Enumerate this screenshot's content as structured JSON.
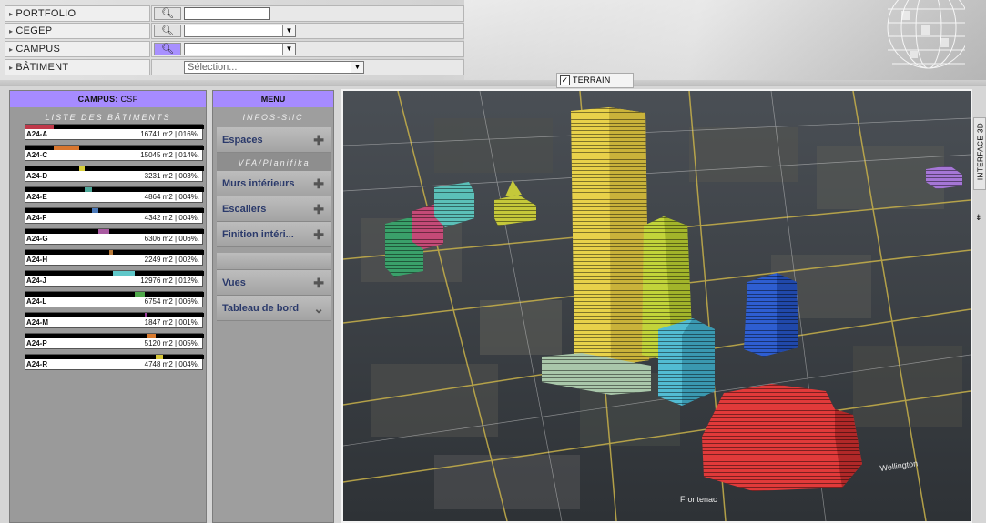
{
  "filters": {
    "portfolio_label": "PORTFOLIO",
    "cegep_label": "CEGEP",
    "campus_label": "CAMPUS",
    "batiment_label": "BÂTIMENT",
    "batiment_placeholder": "Sélection...",
    "search_icon": "magnifier-icon"
  },
  "terrain": {
    "label": "TERRAIN",
    "checked": true
  },
  "campus_panel": {
    "header_label": "CAMPUS:",
    "header_value": "CSF",
    "list_title": "LISTE DES BÂTIMENTS",
    "buildings": [
      {
        "code": "A24-A",
        "info": "16741 m2 | 016%.",
        "color": "#c0394a",
        "fraction": 0.16
      },
      {
        "code": "A24-C",
        "info": "15045 m2 | 014%.",
        "color": "#d9762e",
        "fraction": 0.14
      },
      {
        "code": "A24-D",
        "info": "3231 m2 | 003%.",
        "color": "#d8cf3a",
        "fraction": 0.03
      },
      {
        "code": "A24-E",
        "info": "4864 m2 | 004%.",
        "color": "#4fa89a",
        "fraction": 0.04
      },
      {
        "code": "A24-F",
        "info": "4342 m2 | 004%.",
        "color": "#4a78b8",
        "fraction": 0.04
      },
      {
        "code": "A24-G",
        "info": "6306 m2 | 006%.",
        "color": "#a85aa0",
        "fraction": 0.06
      },
      {
        "code": "A24-H",
        "info": "2249 m2 | 002%.",
        "color": "#b87a3a",
        "fraction": 0.02
      },
      {
        "code": "A24-J",
        "info": "12976 m2 | 012%.",
        "color": "#5fc7c9",
        "fraction": 0.12
      },
      {
        "code": "A24-L",
        "info": "6754 m2 | 006%.",
        "color": "#4ea84a",
        "fraction": 0.06
      },
      {
        "code": "A24-M",
        "info": "1847 m2 | 001%.",
        "color": "#9a3a9a",
        "fraction": 0.01
      },
      {
        "code": "A24-P",
        "info": "5120 m2 | 005%.",
        "color": "#d97a2e",
        "fraction": 0.05
      },
      {
        "code": "A24-R",
        "info": "4748 m2 | 004%.",
        "color": "#d8c83a",
        "fraction": 0.04
      }
    ]
  },
  "menu": {
    "title": "MENU",
    "section1": "INFOS-SilC",
    "section2": "VFA/Planifika",
    "items": {
      "espaces": "Espaces",
      "murs": "Murs intérieurs",
      "escaliers": "Escaliers",
      "finition": "Finition intéri...",
      "vues": "Vues",
      "tableau": "Tableau de bord"
    }
  },
  "side_tab": {
    "label": "INTERFACE 3D"
  },
  "map_labels": {
    "street1": "Frontenac",
    "street2": "Wellington"
  },
  "colors": {
    "accent": "#a68bff",
    "menu_text": "#2b3a6b"
  }
}
